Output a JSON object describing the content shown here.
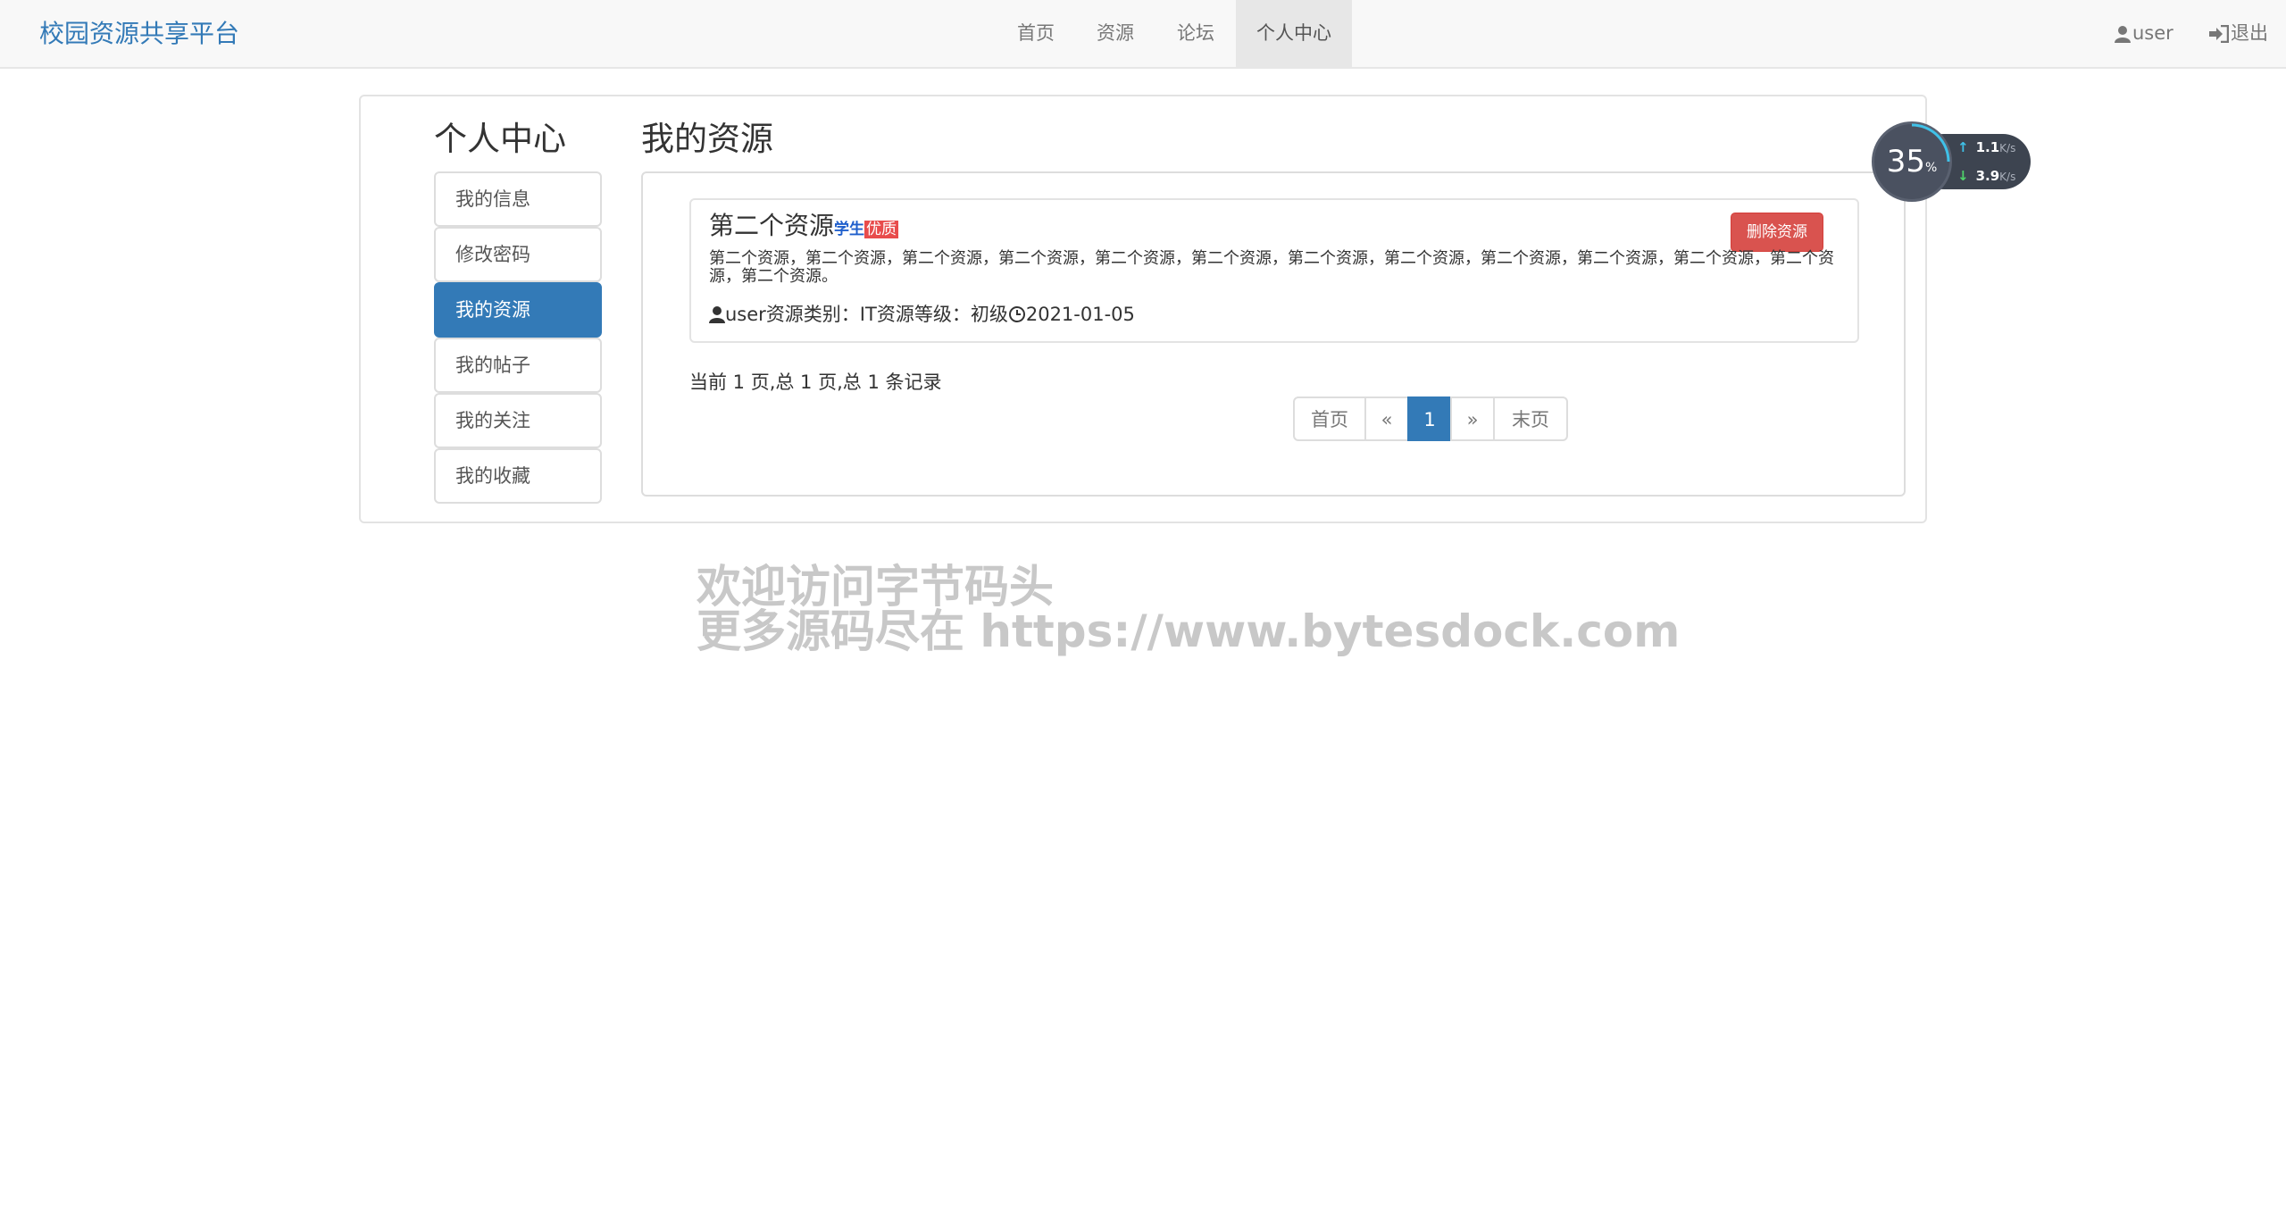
{
  "navbar": {
    "brand": "校园资源共享平台",
    "items": [
      {
        "label": "首页"
      },
      {
        "label": "资源"
      },
      {
        "label": "论坛"
      },
      {
        "label": "个人中心",
        "active": true
      }
    ],
    "user_label": "user",
    "logout_label": "退出"
  },
  "sidebar": {
    "title": "个人中心",
    "items": [
      {
        "label": "我的信息"
      },
      {
        "label": "修改密码"
      },
      {
        "label": "我的资源",
        "active": true
      },
      {
        "label": "我的帖子"
      },
      {
        "label": "我的关注"
      },
      {
        "label": "我的收藏"
      }
    ]
  },
  "main": {
    "title": "我的资源",
    "resources": [
      {
        "title": "第二个资源",
        "badge_student": "学生",
        "badge_quality": "优质",
        "delete_label": "删除资源",
        "description": "第二个资源，第二个资源，第二个资源，第二个资源，第二个资源，第二个资源，第二个资源，第二个资源，第二个资源，第二个资源，第二个资源，第二个资源，第二个资源。",
        "author": "user",
        "category_text": "资源类别：IT资源等级：初级",
        "date": "2021-01-05"
      }
    ],
    "page_info": "当前 1 页,总 1 页,总 1 条记录",
    "pagination": {
      "first": "首页",
      "prev": "«",
      "current": "1",
      "next": "»",
      "last": "末页"
    }
  },
  "watermark": {
    "line1": "欢迎访问字节码头",
    "line2": "更多源码尽在  https://www.bytesdock.com"
  },
  "speed_widget": {
    "percent": "35",
    "percent_unit": "%",
    "upload": "1.1",
    "download": "3.9",
    "unit": "K/s"
  },
  "colors": {
    "primary": "#337ab7",
    "danger": "#d9534f",
    "navbar_bg": "#f8f8f8",
    "border": "#dddddd"
  }
}
